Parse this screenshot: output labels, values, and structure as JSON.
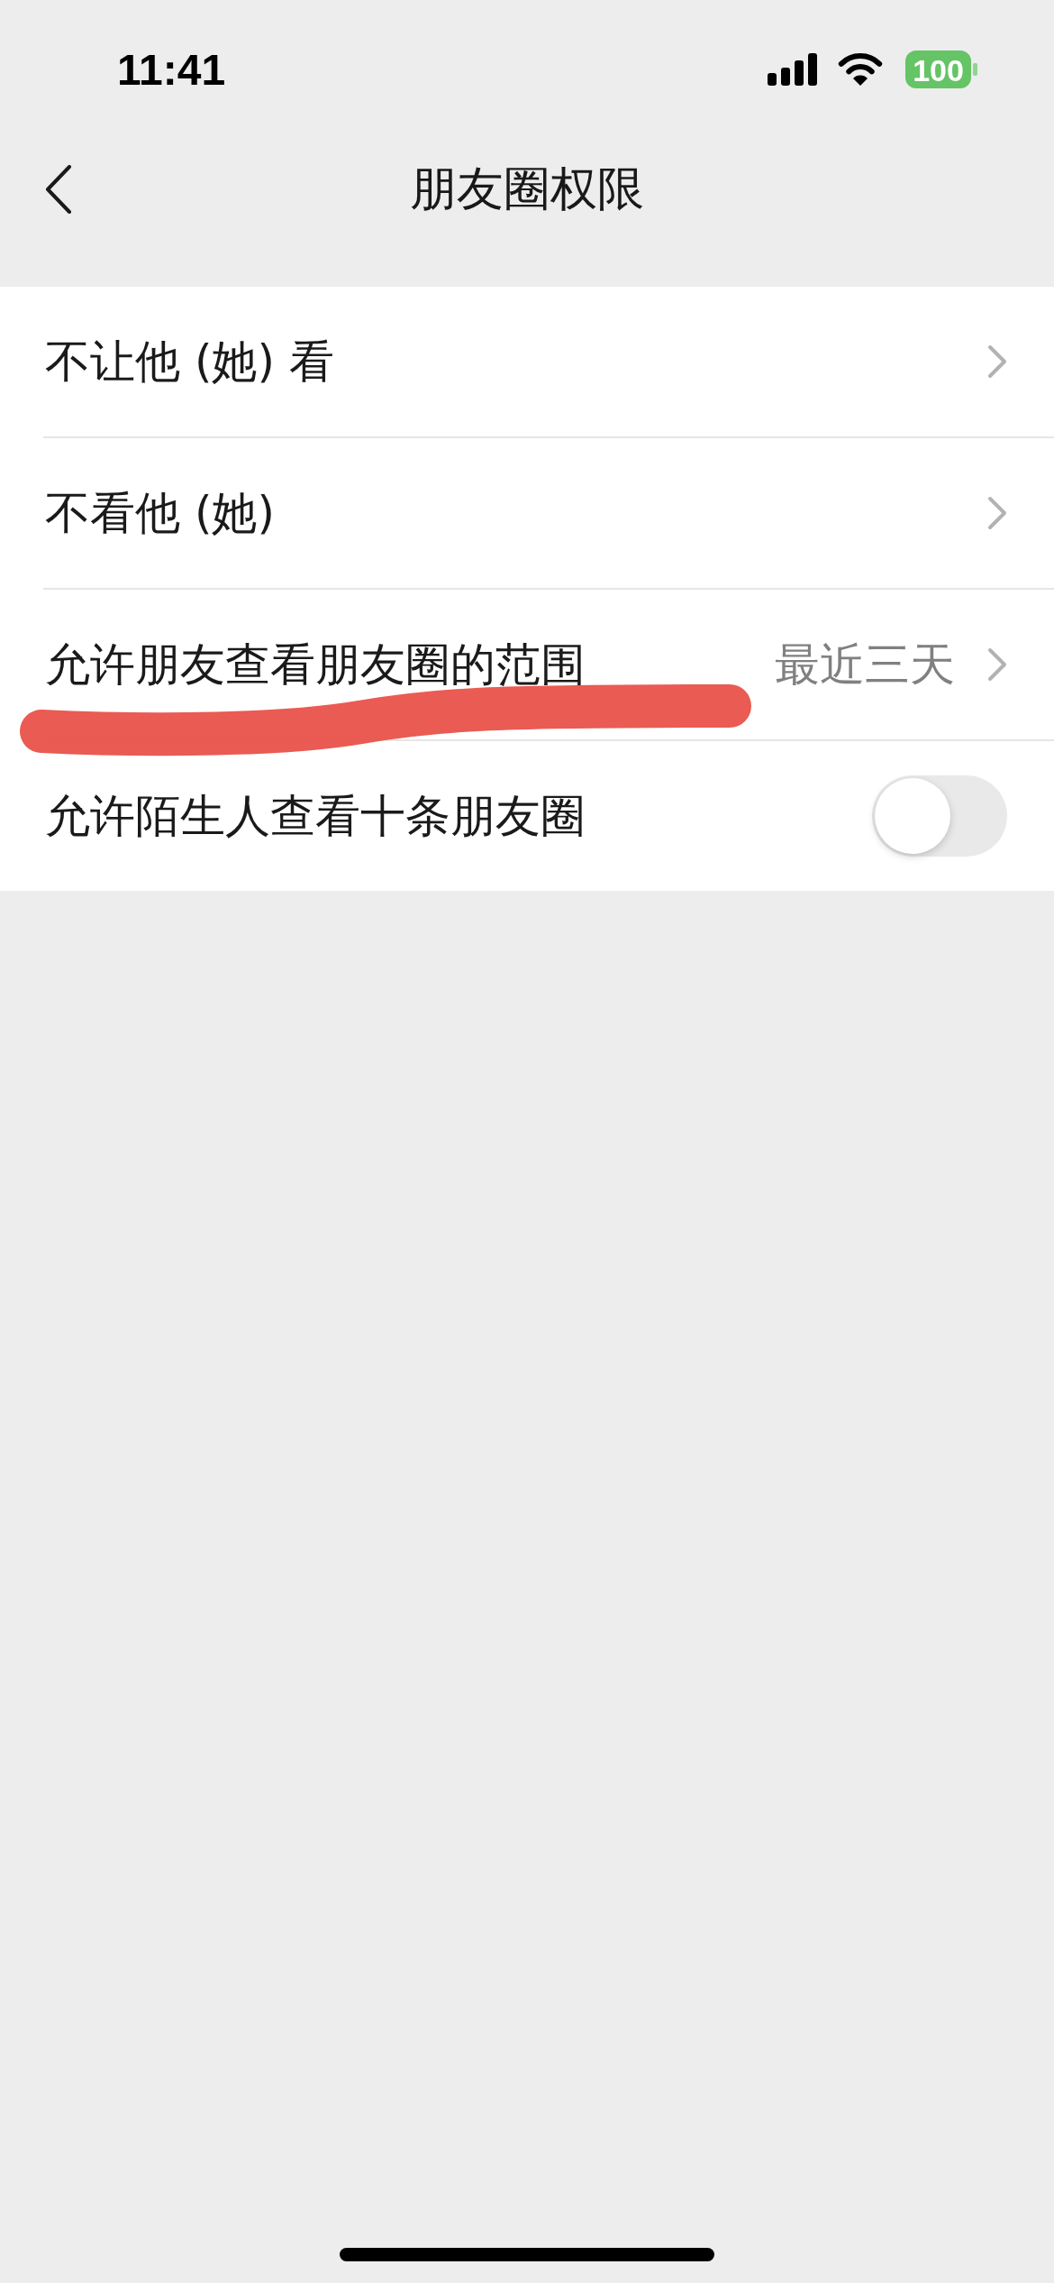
{
  "status_bar": {
    "time": "11:41",
    "battery": "100"
  },
  "nav": {
    "title": "朋友圈权限"
  },
  "rows": [
    {
      "kind": "link",
      "label": "不让他 (她) 看",
      "highlighted": false
    },
    {
      "kind": "link",
      "label": "不看他 (她)",
      "highlighted": false
    },
    {
      "kind": "link",
      "label": "允许朋友查看朋友圈的范围",
      "value": "最近三天",
      "highlighted": true
    },
    {
      "kind": "switch",
      "label": "允许陌生人查看十条朋友圈",
      "on": false,
      "highlighted": false
    }
  ]
}
